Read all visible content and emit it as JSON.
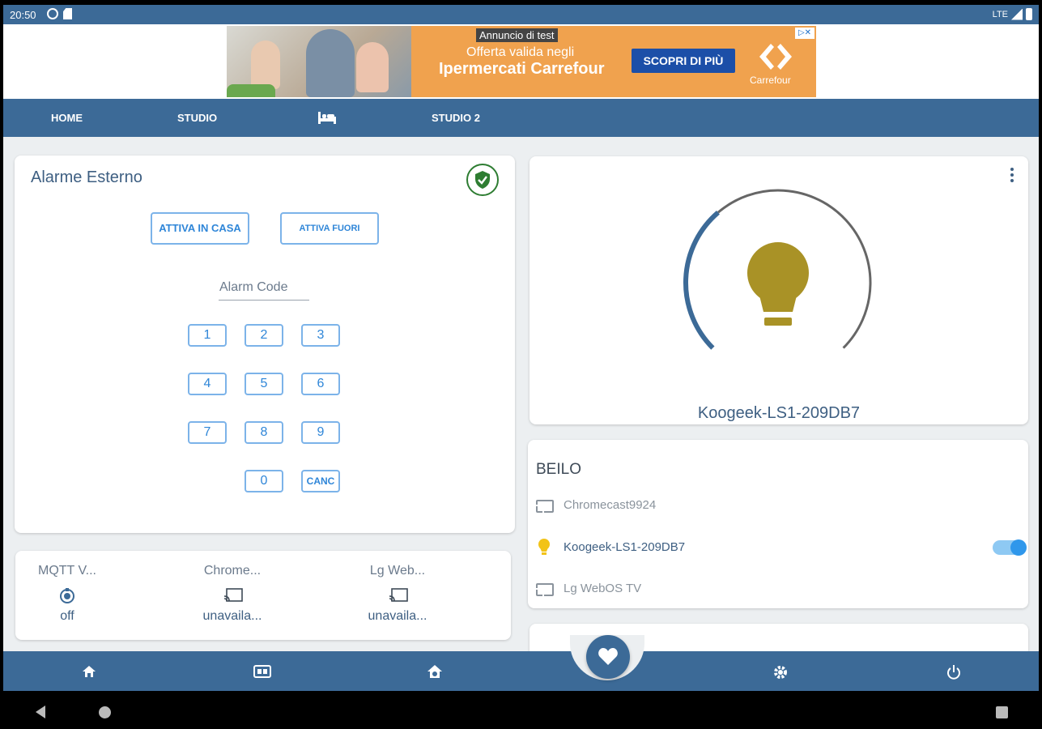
{
  "status_bar": {
    "time": "20:50",
    "network": "LTE"
  },
  "ad": {
    "label": "Annuncio di test",
    "line1": "Offerta valida negli",
    "line2": "Ipermercati Carrefour",
    "cta": "SCOPRI DI PIÙ",
    "brand": "Carrefour"
  },
  "tabs": [
    {
      "label": "HOME"
    },
    {
      "label": "STUDIO"
    },
    {
      "label": "",
      "icon": "bed-icon"
    },
    {
      "label": "STUDIO 2"
    }
  ],
  "alarm": {
    "title": "Alarme Esterno",
    "status_icon": "shield-check-icon",
    "status_color": "#2e7d32",
    "arm_home": "ATTIVA IN CASA",
    "arm_away": "ATTIVA FUORI",
    "code_placeholder": "Alarm Code",
    "keys": [
      "1",
      "2",
      "3",
      "4",
      "5",
      "6",
      "7",
      "8",
      "9",
      "0"
    ],
    "cancel": "CANC"
  },
  "light": {
    "name": "Koogeek-LS1-209DB7",
    "bulb_color": "#a99226",
    "ring_color": "#3c6a97",
    "brightness_percent": 35
  },
  "beilo": {
    "title": "BEILO",
    "devices": [
      {
        "name": "Chromecast9924",
        "icon": "cast-icon",
        "active": false
      },
      {
        "name": "Koogeek-LS1-209DB7",
        "icon": "bulb-icon",
        "active": true,
        "toggle": true
      },
      {
        "name": "Lg WebOS TV",
        "icon": "cast-icon",
        "active": false
      }
    ]
  },
  "mqtt": {
    "items": [
      {
        "name": "MQTT V...",
        "state": "off",
        "icon": "fan-icon"
      },
      {
        "name": "Chrome...",
        "state": "unavaila...",
        "icon": "cast-icon"
      },
      {
        "name": "Lg Web...",
        "state": "unavaila...",
        "icon": "cast-icon"
      }
    ]
  },
  "bottom_nav": {
    "items": [
      "home-icon",
      "dashboard-icon",
      "house-settings-icon",
      "favorites-heart-icon",
      "settings-icon",
      "power-icon"
    ]
  },
  "colors": {
    "primary": "#3c6a97",
    "accent": "#2f86d8"
  }
}
